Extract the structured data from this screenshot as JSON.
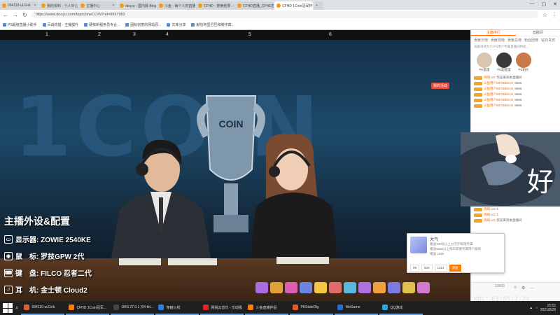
{
  "browser": {
    "tabs": [
      {
        "label": "094110-uLGnk",
        "active": false
      },
      {
        "label": "我的资料 - 个人中心 - 斗鱼",
        "active": false
      },
      {
        "label": "主播中心",
        "active": false
      },
      {
        "label": "douyu - 国内版 Bing",
        "active": false
      },
      {
        "label": "斗鱼 - 每个人的直播平台",
        "active": false
      },
      {
        "label": "CFHD - 搜索结果 - 斗鱼直",
        "active": false
      },
      {
        "label": "CFHD直播_CFHD直播间",
        "active": false
      },
      {
        "label": "CFHD 1Coin冠军杯",
        "active": true
      }
    ],
    "url": "https://www.douyu.com/topic/oneCOIN?rid=8997983",
    "bookmarks": [
      "PS超级直播小助手",
      "百战先提 - 主播提升",
      "硬核新程序员专业...",
      "图标创意的网站原...",
      "文库分享",
      "献仿阿里巴巴和制作高..."
    ],
    "window_controls": [
      "—",
      "▢",
      "✕"
    ]
  },
  "player": {
    "top_numbers": [
      "1",
      "2",
      "3",
      "4",
      "5",
      "6"
    ],
    "watermark": "1COIN",
    "trophy_text": "COIN",
    "badge": "我的活动",
    "overlay": {
      "heading": "主播外设&配置",
      "rows": [
        {
          "icon": "monitor-icon",
          "glyph": "▭",
          "label": "显示器: ZOWIE 2540KE"
        },
        {
          "icon": "mouse-icon",
          "glyph": "◉",
          "label": "鼠　标: 罗技GPW 2代"
        },
        {
          "icon": "keyboard-icon",
          "glyph": "⌨",
          "label": "键　盘: FILCO 忍者二代"
        },
        {
          "icon": "headset-icon",
          "glyph": "♫",
          "label": "耳　机: 金士顿 Cloud2"
        }
      ]
    }
  },
  "side": {
    "tabs": [
      "主播排行",
      "直播间",
      ""
    ],
    "sub_tabs": [
      "贡献日榜",
      "贡献周榜",
      "贡献总榜",
      "粉丝团榜",
      "钻石贵宾"
    ],
    "notice": "贡献日榜为TOP3用户专属直播间特权...",
    "ranks": [
      {
        "name": "PE蛋蛋",
        "color": "#d9c7b1"
      },
      {
        "name": "PE超蛋蛋",
        "color": "#3a3a3a"
      },
      {
        "name": "PE柏文",
        "color": "#c8784a"
      }
    ],
    "chat": [
      {
        "user": "闹闹123",
        "text": "欢迎来到本直播间"
      },
      {
        "user": "斗鱼用户MFOBbKzO",
        "text": "6666"
      },
      {
        "user": "斗鱼用户MFOBbKzO",
        "text": "6666"
      },
      {
        "user": "斗鱼用户MFOBbKzO",
        "text": "6666"
      },
      {
        "user": "斗鱼用户MFOBbKzO",
        "text": "6666"
      },
      {
        "user": "斗鱼用户MFOBbKzO",
        "text": "6666"
      }
    ],
    "chat2": [
      {
        "user": "Phoen2guo",
        "text": "欢迎来到本直播间"
      },
      {
        "user": "闹闹123",
        "text": "欢迎来到本直播间"
      },
      {
        "user": "闹闹123",
        "text": "1"
      },
      {
        "user": "闹闹123",
        "text": "1"
      },
      {
        "user": "闹闹123",
        "text": "1"
      },
      {
        "user": "闹闹123",
        "text": "1"
      },
      {
        "user": "闹闹123",
        "text": "欢迎来到本直播间"
      }
    ],
    "cam_char": "好",
    "popup": {
      "title": "大气",
      "lines": [
        "赠送100钻以上分守护助理专属",
        "赠送6666以上每日获赠专属用户徽章",
        "赠送 1599"
      ],
      "buttons": [
        "99",
        "520",
        "1314",
        "赠送"
      ]
    },
    "bottom": {
      "count": "10000",
      "ticker": "KDL：E1:55:7:74"
    }
  },
  "taskbar": {
    "apps": [
      {
        "label": "094110-uLGnk",
        "color": "#d95f3a"
      },
      {
        "label": "CFHD 1Coin冠军...",
        "color": "#ff7a00"
      },
      {
        "label": "OBS 27.0.1 (64-bit...",
        "color": "#444"
      },
      {
        "label": "穿越火线",
        "color": "#2b7de9"
      },
      {
        "label": "网易云音乐 - 乐动极",
        "color": "#e0262b"
      },
      {
        "label": "斗鱼直播伴侣",
        "color": "#ff7a00"
      },
      {
        "label": "PKStateDlg",
        "color": "#e85a20"
      },
      {
        "label": "WeGame",
        "color": "#2a6ad8"
      },
      {
        "label": "QQ游戏",
        "color": "#28a8e0"
      }
    ],
    "time": "15:52",
    "date": "2021/8/28"
  }
}
